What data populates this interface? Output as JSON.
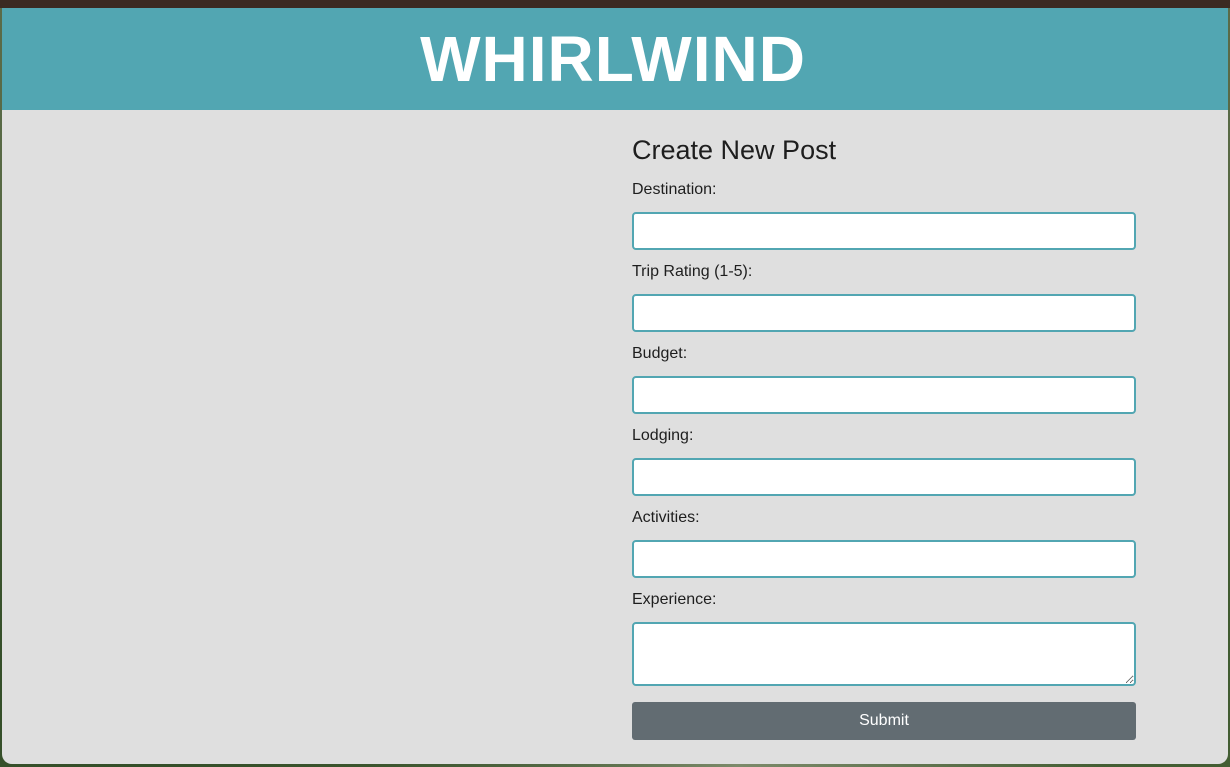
{
  "header": {
    "title": "WHIRLWIND"
  },
  "form": {
    "title": "Create New Post",
    "fields": [
      {
        "label": "Destination:",
        "value": ""
      },
      {
        "label": "Trip Rating (1-5):",
        "value": ""
      },
      {
        "label": "Budget:",
        "value": ""
      },
      {
        "label": "Lodging:",
        "value": ""
      },
      {
        "label": "Activities:",
        "value": ""
      },
      {
        "label": "Experience:",
        "value": ""
      }
    ],
    "submit_label": "Submit"
  },
  "colors": {
    "header_bg": "#52a6b2",
    "panel_bg": "#dfdfdf",
    "input_border": "#52a6b2",
    "button_bg": "#626c72"
  }
}
